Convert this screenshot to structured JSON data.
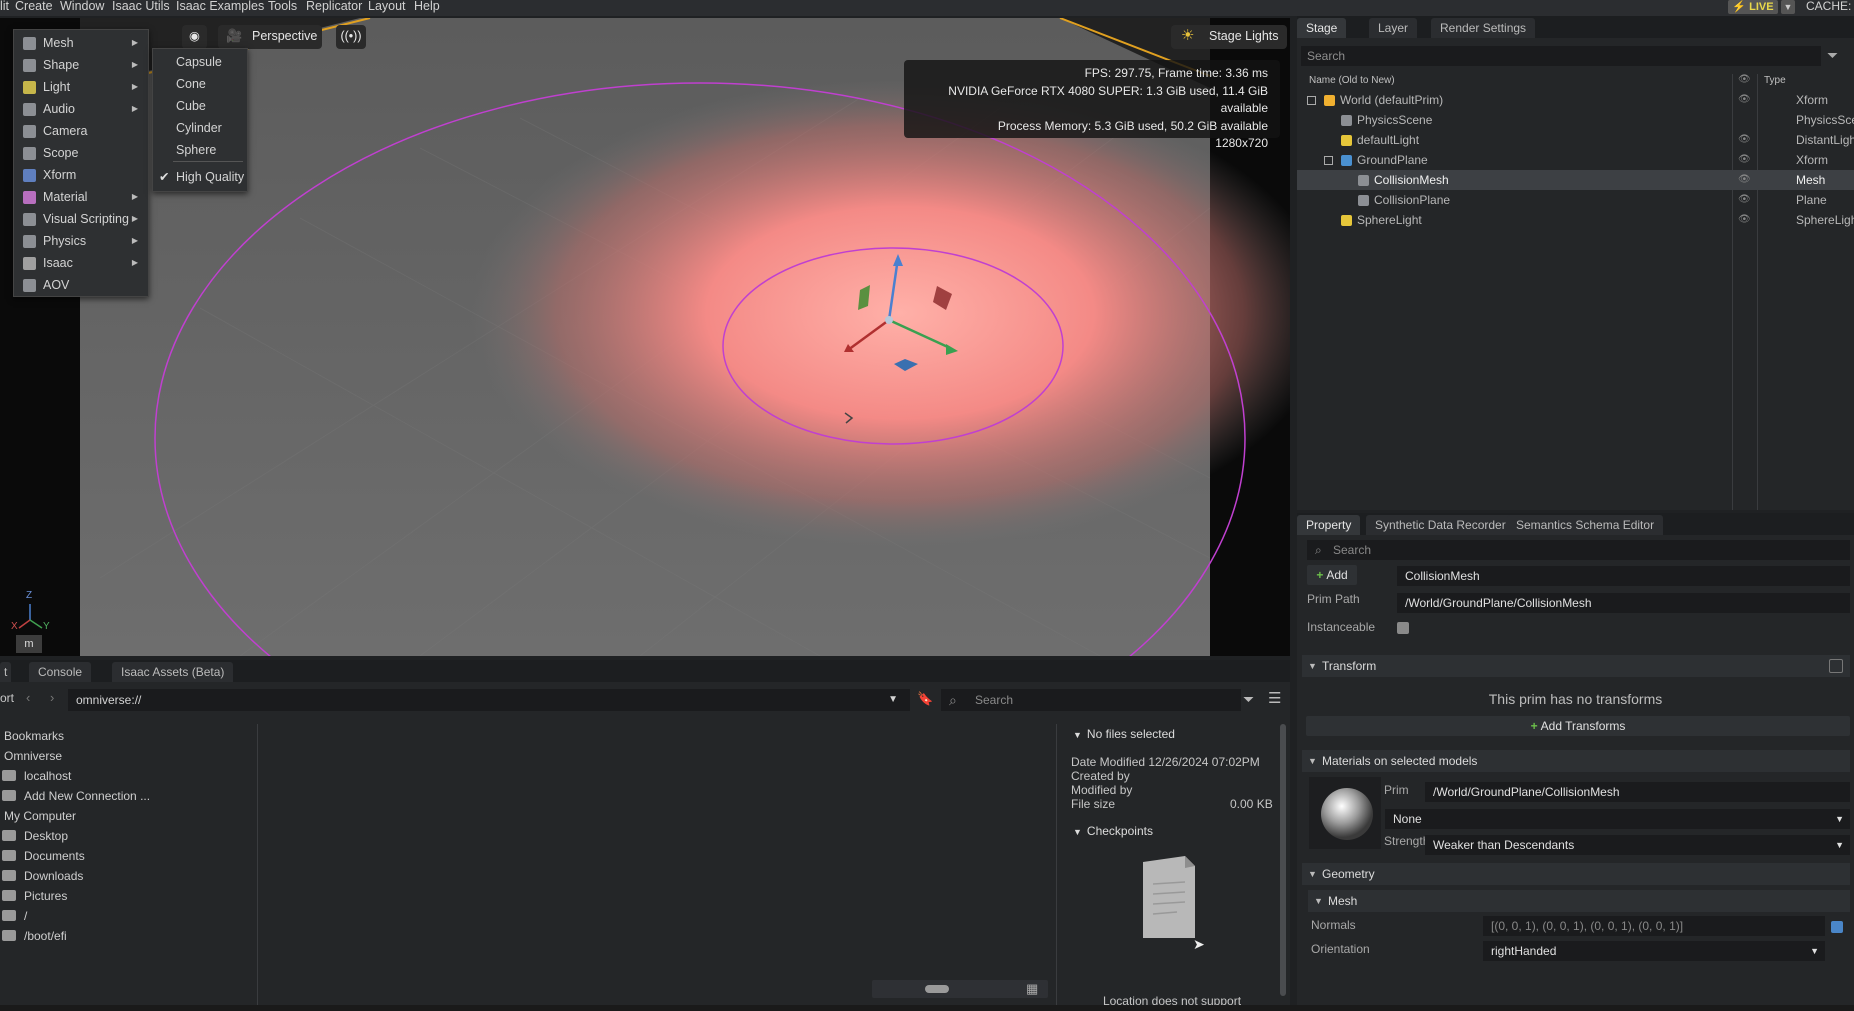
{
  "menubar": {
    "items": [
      "lit",
      "Create",
      "Window",
      "Isaac Utils",
      "Isaac Examples",
      "Tools",
      "Replicator",
      "Layout",
      "Help"
    ],
    "live_label": "LIVE",
    "cache_label": "CACHE:"
  },
  "create_menu": {
    "items": [
      {
        "label": "Mesh",
        "submenu": true
      },
      {
        "label": "Shape",
        "submenu": true
      },
      {
        "label": "Light",
        "submenu": true
      },
      {
        "label": "Audio",
        "submenu": true
      },
      {
        "label": "Camera",
        "submenu": false
      },
      {
        "label": "Scope",
        "submenu": false
      },
      {
        "label": "Xform",
        "submenu": false
      },
      {
        "label": "Material",
        "submenu": true
      },
      {
        "label": "Visual Scripting",
        "submenu": true
      },
      {
        "label": "Physics",
        "submenu": true
      },
      {
        "label": "Isaac",
        "submenu": true
      },
      {
        "label": "AOV",
        "submenu": false
      }
    ],
    "submenu_items": [
      "Capsule",
      "Cone",
      "Cube",
      "Cylinder",
      "Sphere"
    ],
    "high_quality_label": "High Quality",
    "high_quality_checked": true
  },
  "viewport": {
    "camera_label": "Perspective",
    "lights_label": "Stage Lights",
    "stats": [
      "FPS: 297.75, Frame time: 3.36 ms",
      "NVIDIA GeForce RTX 4080 SUPER: 1.3 GiB used, 11.4 GiB available",
      "Process Memory: 5.3 GiB used, 50.2 GiB available",
      "1280x720"
    ],
    "axis_labels": {
      "z": "Z",
      "x": "X",
      "y": "Y"
    },
    "unit_label": "m"
  },
  "stage": {
    "tabs": [
      "Stage",
      "Layer",
      "Render Settings"
    ],
    "search_placeholder": "Search",
    "col_name": "Name (Old to New)",
    "col_type": "Type",
    "rows": [
      {
        "name": "World (defaultPrim)",
        "type": "Xform",
        "selected": false
      },
      {
        "name": "PhysicsScene",
        "type": "PhysicsScene",
        "selected": false
      },
      {
        "name": "defaultLight",
        "type": "DistantLight",
        "selected": false
      },
      {
        "name": "GroundPlane",
        "type": "Xform",
        "selected": false
      },
      {
        "name": "CollisionMesh",
        "type": "Mesh",
        "selected": true
      },
      {
        "name": "CollisionPlane",
        "type": "Plane",
        "selected": false
      },
      {
        "name": "SphereLight",
        "type": "SphereLight",
        "selected": false
      }
    ]
  },
  "property": {
    "tabs": [
      "Property",
      "Synthetic Data Recorder",
      "Semantics Schema Editor"
    ],
    "search_placeholder": "Search",
    "add_label": "Add",
    "prim_name": "CollisionMesh",
    "prim_path_label": "Prim Path",
    "prim_path": "/World/GroundPlane/CollisionMesh",
    "instanceable_label": "Instanceable",
    "transform_header": "Transform",
    "no_transforms": "This prim has no transforms",
    "add_transforms_label": "Add Transforms",
    "materials_header": "Materials on selected models",
    "prim_label": "Prim",
    "material_prim": "/World/GroundPlane/CollisionMesh",
    "material_value": "None",
    "strength_label": "Strength",
    "strength_value": "Weaker than Descendants",
    "geometry_header": "Geometry",
    "mesh_header": "Mesh",
    "normals_label": "Normals",
    "normals_value": "[(0, 0, 1), (0, 0, 1), (0, 0, 1), (0, 0, 1)]",
    "orientation_label": "Orientation",
    "orientation_value": "rightHanded"
  },
  "content_browser": {
    "tabs": [
      "t",
      "Console",
      "Isaac Assets (Beta)"
    ],
    "left_tab_partial": "ort",
    "path": "omniverse://",
    "search_placeholder": "Search",
    "tree": [
      {
        "label": "Bookmarks",
        "indent": false,
        "drive": false
      },
      {
        "label": "Omniverse",
        "indent": false,
        "drive": false
      },
      {
        "label": "localhost",
        "indent": true,
        "drive": true
      },
      {
        "label": "Add New Connection ...",
        "indent": true,
        "drive": true
      },
      {
        "label": "My Computer",
        "indent": false,
        "drive": false
      },
      {
        "label": "Desktop",
        "indent": true,
        "drive": true
      },
      {
        "label": "Documents",
        "indent": true,
        "drive": true
      },
      {
        "label": "Downloads",
        "indent": true,
        "drive": true
      },
      {
        "label": "Pictures",
        "indent": true,
        "drive": true
      },
      {
        "label": "/",
        "indent": true,
        "drive": true
      },
      {
        "label": "/boot/efi",
        "indent": true,
        "drive": true
      }
    ],
    "no_files_label": "No files selected",
    "date_modified": "Date Modified 12/26/2024 07:02PM",
    "created_by": "Created by",
    "modified_by": "Modified by",
    "file_size_label": "File size",
    "file_size_value": "0.00 KB",
    "checkpoints_label": "Checkpoints",
    "location_msg": "Location does not support"
  },
  "colors": {
    "accent_green": "#6cc04a",
    "selection_magenta": "#c040d0",
    "light_glow": "#ff7070"
  }
}
